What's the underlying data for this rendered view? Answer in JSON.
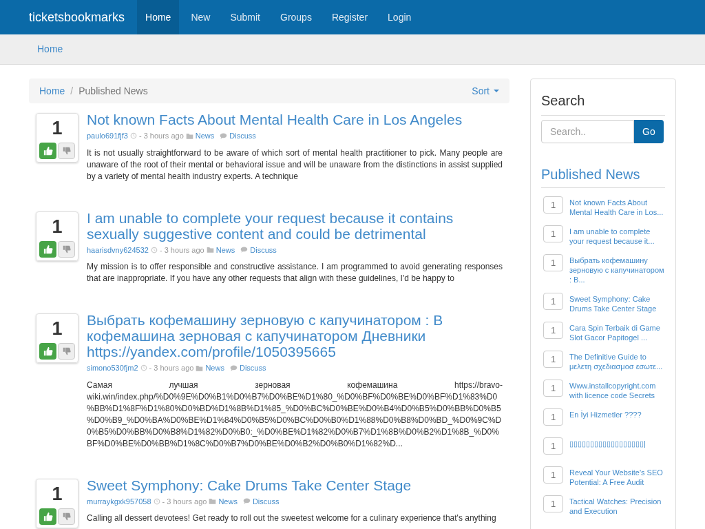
{
  "navbar": {
    "brand": "ticketsbookmarks",
    "items": [
      {
        "label": "Home",
        "selected": true
      },
      {
        "label": "New",
        "selected": false
      },
      {
        "label": "Submit",
        "selected": false
      },
      {
        "label": "Groups",
        "selected": false
      },
      {
        "label": "Register",
        "selected": false
      },
      {
        "label": "Login",
        "selected": false
      }
    ]
  },
  "top_breadcrumb": "Home",
  "breadcrumb": {
    "items": [
      "Home",
      "Published News"
    ],
    "separator": "/",
    "sort": "Sort"
  },
  "articles": [
    {
      "votes": "1",
      "title": "Not known Facts About Mental Health Care in Los Angeles",
      "author": "paulo691fjf3",
      "time": "- 3 hours ago",
      "category": "News",
      "discuss": "Discuss",
      "excerpt": "It is not usually straightforward to be aware of which sort of mental health practitioner to pick. Many people are unaware of the root of their mental or behavioral issue and will be unaware from the distinctions in assist supplied by a variety of mental health industry experts. A technique"
    },
    {
      "votes": "1",
      "title": "I am unable to complete your request because it contains sexually suggestive content and could be detrimental",
      "author": "haarisdvny624532",
      "time": "- 3 hours ago",
      "category": "News",
      "discuss": "Discuss",
      "excerpt": "My mission is to offer responsible and constructive assistance. I am programmed to avoid generating responses that are inappropriate. If you have any other requests that align with these guidelines, I'd be happy to"
    },
    {
      "votes": "1",
      "title": "Выбрать кофемашину зерновую с капучинатором : В кофемашина зерновая с капучинатором Дневники https://yandex.com/profile/1050395665",
      "author": "simono530fjm2",
      "time": "- 3 hours ago",
      "category": "News",
      "discuss": "Discuss",
      "excerpt": "Самая лучшая зерновая кофемашина https://bravo-wiki.win/index.php/%D0%9E%D0%B1%D0%B7%D0%BE%D1%80_%D0%BF%D0%BE%D0%BF%D1%83%D0%BB%D1%8F%D1%80%D0%BD%D1%8B%D1%85_%D0%BC%D0%BE%D0%B4%D0%B5%D0%BB%D0%B5%D0%B9_%D0%BA%D0%BE%D1%84%D0%B5%D0%BC%D0%B0%D1%88%D0%B8%D0%BD_%D0%9C%D0%B5%D0%BB%D0%B8%D1%82%D0%B0:_%D0%BE%D1%82%D0%B7%D1%8B%D0%B2%D1%8B_%D0%BF%D0%BE%D0%BB%D1%8C%D0%B7%D0%BE%D0%B2%D0%B0%D1%82%D..."
    },
    {
      "votes": "1",
      "title": "Sweet Symphony: Cake Drums Take Center Stage",
      "author": "murraykgxk957058",
      "time": "- 3 hours ago",
      "category": "News",
      "discuss": "Discuss",
      "excerpt": "Calling all dessert devotees! Get ready to roll out the sweetest welcome for a culinary experience that's anything"
    }
  ],
  "sidebar": {
    "search_title": "Search",
    "search_placeholder": "Search..",
    "search_button": "Go",
    "news_title": "Published News",
    "items": [
      {
        "votes": "1",
        "title": "Not known Facts About Mental Health Care in Los..."
      },
      {
        "votes": "1",
        "title": "I am unable to complete your request because it..."
      },
      {
        "votes": "1",
        "title": "Выбрать кофемашину зерновую с капучинатором : В..."
      },
      {
        "votes": "1",
        "title": "Sweet Symphony: Cake Drums Take Center Stage"
      },
      {
        "votes": "1",
        "title": "Cara Spin Terbaik di Game Slot Gacor Papitogel ..."
      },
      {
        "votes": "1",
        "title": "The Definitive Guide to μελετη σχεδιασμοσ εσωτε..."
      },
      {
        "votes": "1",
        "title": "Www.installcopyright.com with licence code Secrets"
      },
      {
        "votes": "1",
        "title": "En İyi Hizmetler ????"
      },
      {
        "votes": "1",
        "title": "▯▯▯▯▯▯▯▯▯▯▯▯▯▯▯▯▯▯|"
      },
      {
        "votes": "1",
        "title": "Reveal Your Website's SEO Potential: A Free Audit"
      },
      {
        "votes": "1",
        "title": "Tactical Watches: Precision and Execution"
      }
    ]
  }
}
